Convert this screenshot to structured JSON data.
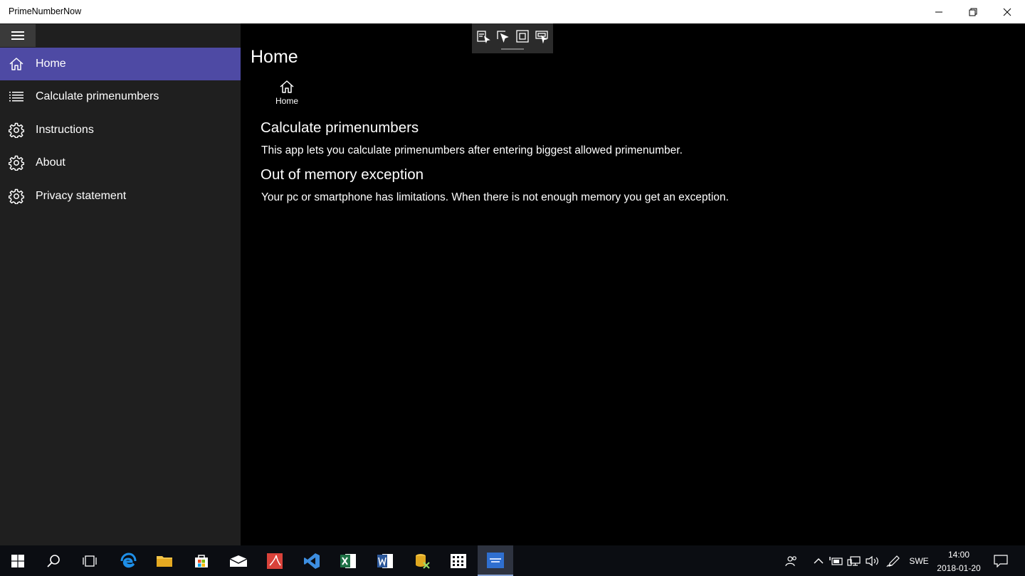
{
  "window": {
    "title": "PrimeNumberNow"
  },
  "nav": {
    "items": [
      {
        "label": "Home",
        "icon": "home-icon",
        "active": true
      },
      {
        "label": "Calculate primenumbers",
        "icon": "list-icon",
        "active": false
      },
      {
        "label": "Instructions",
        "icon": "gear-icon",
        "active": false
      },
      {
        "label": "About",
        "icon": "gear-icon",
        "active": false
      },
      {
        "label": "Privacy statement",
        "icon": "gear-icon",
        "active": false
      }
    ]
  },
  "main": {
    "page_title": "Home",
    "home_button_label": "Home",
    "sections": [
      {
        "heading": "Calculate primenumbers",
        "text": "This app lets you calculate primenumbers after entering biggest allowed primenumber."
      },
      {
        "heading": "Out of memory exception",
        "text": "Your pc or smartphone has limitations. When there is not enough memory you get an exception."
      }
    ]
  },
  "taskbar": {
    "language": "SWE",
    "time": "14:00",
    "date": "2018-01-20"
  },
  "colors": {
    "accent": "#4e4aa4",
    "nav_bg": "#1f1f1f",
    "content_bg": "#000000",
    "taskbar_bg": "#0b0d12"
  }
}
